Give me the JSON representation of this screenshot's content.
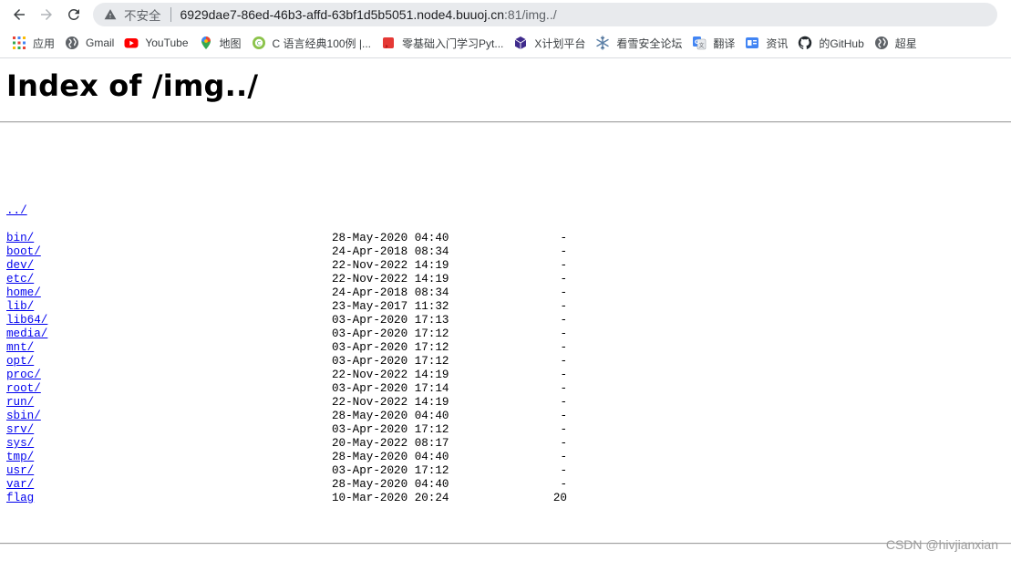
{
  "browser": {
    "back_icon": "arrow-left-icon",
    "forward_icon": "arrow-right-icon",
    "reload_icon": "reload-icon",
    "security_label": "不安全",
    "url_host": "6929dae7-86ed-46b3-affd-63bf1d5b5051.node4.buuoj.cn",
    "url_rest": ":81/img../"
  },
  "bookmarks": [
    {
      "label": "应用",
      "icon": "apps-grid-icon"
    },
    {
      "label": "Gmail",
      "icon": "globe-icon"
    },
    {
      "label": "YouTube",
      "icon": "youtube-icon"
    },
    {
      "label": "地图",
      "icon": "maps-pin-icon"
    },
    {
      "label": "C 语言经典100例 |...",
      "icon": "c-lang-icon"
    },
    {
      "label": "零基础入门学习Pyt...",
      "icon": "red-book-icon"
    },
    {
      "label": "X计划平台",
      "icon": "cube-icon"
    },
    {
      "label": "看雪安全论坛",
      "icon": "snowflake-icon"
    },
    {
      "label": "翻译",
      "icon": "translate-icon"
    },
    {
      "label": "资讯",
      "icon": "news-icon"
    },
    {
      "label": "的GitHub",
      "icon": "github-icon"
    },
    {
      "label": "超星",
      "icon": "globe-icon"
    }
  ],
  "page": {
    "title": "Index of /img../",
    "parent_link": "../",
    "entries": [
      {
        "name": "bin/",
        "date": "28-May-2020 04:40",
        "size": "-"
      },
      {
        "name": "boot/",
        "date": "24-Apr-2018 08:34",
        "size": "-"
      },
      {
        "name": "dev/",
        "date": "22-Nov-2022 14:19",
        "size": "-"
      },
      {
        "name": "etc/",
        "date": "22-Nov-2022 14:19",
        "size": "-"
      },
      {
        "name": "home/",
        "date": "24-Apr-2018 08:34",
        "size": "-"
      },
      {
        "name": "lib/",
        "date": "23-May-2017 11:32",
        "size": "-"
      },
      {
        "name": "lib64/",
        "date": "03-Apr-2020 17:13",
        "size": "-"
      },
      {
        "name": "media/",
        "date": "03-Apr-2020 17:12",
        "size": "-"
      },
      {
        "name": "mnt/",
        "date": "03-Apr-2020 17:12",
        "size": "-"
      },
      {
        "name": "opt/",
        "date": "03-Apr-2020 17:12",
        "size": "-"
      },
      {
        "name": "proc/",
        "date": "22-Nov-2022 14:19",
        "size": "-"
      },
      {
        "name": "root/",
        "date": "03-Apr-2020 17:14",
        "size": "-"
      },
      {
        "name": "run/",
        "date": "22-Nov-2022 14:19",
        "size": "-"
      },
      {
        "name": "sbin/",
        "date": "28-May-2020 04:40",
        "size": "-"
      },
      {
        "name": "srv/",
        "date": "03-Apr-2020 17:12",
        "size": "-"
      },
      {
        "name": "sys/",
        "date": "20-May-2022 08:17",
        "size": "-"
      },
      {
        "name": "tmp/",
        "date": "28-May-2020 04:40",
        "size": "-"
      },
      {
        "name": "usr/",
        "date": "03-Apr-2020 17:12",
        "size": "-"
      },
      {
        "name": "var/",
        "date": "28-May-2020 04:40",
        "size": "-"
      },
      {
        "name": "flag",
        "date": "10-Mar-2020 20:24",
        "size": "20"
      }
    ]
  },
  "watermark": "CSDN @hivjianxian"
}
